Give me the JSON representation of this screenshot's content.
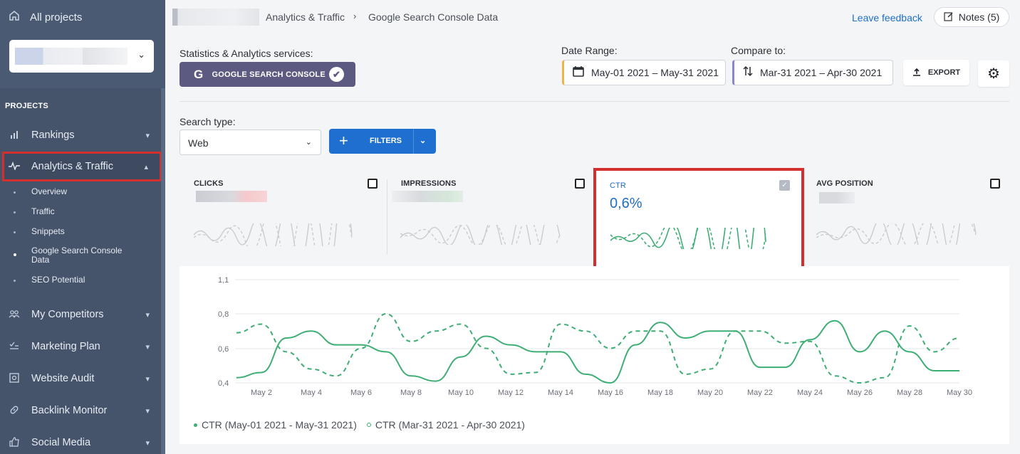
{
  "sidebar": {
    "all_projects": "All projects",
    "section_label": "PROJECTS",
    "items": [
      {
        "label": "Rankings",
        "icon": "bar-chart-icon"
      },
      {
        "label": "Analytics & Traffic",
        "icon": "pulse-icon",
        "active": true
      },
      {
        "label": "My Competitors",
        "icon": "users-icon"
      },
      {
        "label": "Marketing Plan",
        "icon": "checklist-icon"
      },
      {
        "label": "Website Audit",
        "icon": "audit-icon"
      },
      {
        "label": "Backlink Monitor",
        "icon": "link-icon"
      },
      {
        "label": "Social Media",
        "icon": "thumbs-up-icon"
      }
    ],
    "subitems": [
      {
        "label": "Overview"
      },
      {
        "label": "Traffic"
      },
      {
        "label": "Snippets"
      },
      {
        "label": "Google Search Console Data",
        "active": true
      },
      {
        "label": "SEO Potential"
      }
    ]
  },
  "header": {
    "breadcrumb_section": "Analytics & Traffic",
    "breadcrumb_page": "Google Search Console Data",
    "feedback": "Leave feedback",
    "notes": "Notes (5)"
  },
  "controls": {
    "services_label": "Statistics & Analytics services:",
    "service": "GOOGLE SEARCH CONSOLE",
    "date_range_label": "Date Range:",
    "date_range": "May-01 2021 – May-31 2021",
    "compare_label": "Compare to:",
    "compare_range": "Mar-31 2021 – Apr-30 2021",
    "export": "EXPORT",
    "search_type_label": "Search type:",
    "search_type": "Web",
    "filters": "FILTERS"
  },
  "metrics": {
    "clicks": "CLICKS",
    "impressions": "IMPRESSIONS",
    "ctr": "CTR",
    "ctr_value": "0,6%",
    "avg_position": "AVG POSITION"
  },
  "colors": {
    "sidebar": "#45536b",
    "accent_blue": "#1e6fd0",
    "service_purple": "#5c5a80",
    "series_green": "#3fae75",
    "highlight_red": "#d32f2f"
  },
  "chart_data": {
    "type": "line",
    "y_ticks": [
      "0,4",
      "0,6",
      "0,8",
      "1,1"
    ],
    "x_ticks": [
      "May 2",
      "May 4",
      "May 6",
      "May 8",
      "May 10",
      "May 12",
      "May 14",
      "May 16",
      "May 18",
      "May 20",
      "May 22",
      "May 24",
      "May 26",
      "May 28",
      "May 30"
    ],
    "ylim": [
      0.4,
      1.1
    ],
    "series": [
      {
        "name": "CTR (May-01 2021 - May-31 2021)",
        "style": "solid",
        "values": [
          0.43,
          0.46,
          0.66,
          0.7,
          0.62,
          0.62,
          0.58,
          0.44,
          0.41,
          0.55,
          0.67,
          0.62,
          0.58,
          0.58,
          0.45,
          0.4,
          0.62,
          0.75,
          0.66,
          0.7,
          0.7,
          0.49,
          0.49,
          0.65,
          0.76,
          0.58,
          0.7,
          0.58,
          0.47,
          0.47
        ]
      },
      {
        "name": "CTR (Mar-31 2021 - Apr-30 2021)",
        "style": "dashed",
        "values": [
          0.69,
          0.74,
          0.58,
          0.48,
          0.44,
          0.6,
          0.8,
          0.64,
          0.7,
          0.74,
          0.6,
          0.45,
          0.46,
          0.74,
          0.7,
          0.6,
          0.7,
          0.7,
          0.45,
          0.48,
          0.7,
          0.7,
          0.63,
          0.64,
          0.44,
          0.4,
          0.43,
          0.73,
          0.58,
          0.66
        ]
      }
    ]
  }
}
